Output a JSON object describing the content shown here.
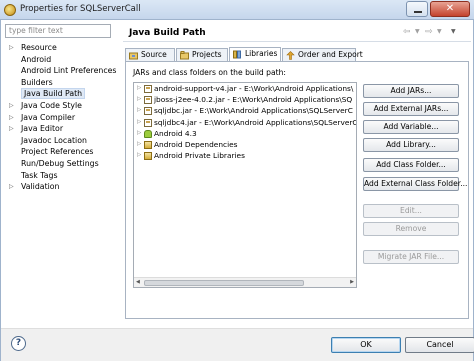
{
  "window": {
    "title": "Properties for SQLServerCall",
    "close_glyph": "✕"
  },
  "filter": {
    "placeholder": "type filter text"
  },
  "tree": [
    {
      "label": "Resource",
      "expandable": true
    },
    {
      "label": "Android",
      "expandable": false
    },
    {
      "label": "Android Lint Preferences",
      "expandable": false
    },
    {
      "label": "Builders",
      "expandable": false
    },
    {
      "label": "Java Build Path",
      "expandable": false,
      "selected": true
    },
    {
      "label": "Java Code Style",
      "expandable": true
    },
    {
      "label": "Java Compiler",
      "expandable": true
    },
    {
      "label": "Java Editor",
      "expandable": true
    },
    {
      "label": "Javadoc Location",
      "expandable": false
    },
    {
      "label": "Project References",
      "expandable": false
    },
    {
      "label": "Run/Debug Settings",
      "expandable": false
    },
    {
      "label": "Task Tags",
      "expandable": false
    },
    {
      "label": "Validation",
      "expandable": true
    }
  ],
  "page": {
    "title": "Java Build Path",
    "tabs": [
      {
        "label": "Source"
      },
      {
        "label": "Projects"
      },
      {
        "label": "Libraries"
      },
      {
        "label": "Order and Export"
      }
    ],
    "description": "JARs and class folders on the build path:"
  },
  "libraries": [
    {
      "label": "android-support-v4.jar - E:\\Work\\Android Applications\\",
      "icon": "jar-icon"
    },
    {
      "label": "jboss-j2ee-4.0.2.jar - E:\\Work\\Android Applications\\SQ",
      "icon": "jar-icon"
    },
    {
      "label": "sqljdbc.jar - E:\\Work\\Android Applications\\SQLServerC",
      "icon": "jar-icon"
    },
    {
      "label": "sqljdbc4.jar - E:\\Work\\Android Applications\\SQLServerC",
      "icon": "jar-icon"
    },
    {
      "label": "Android 4.3",
      "icon": "android-icon"
    },
    {
      "label": "Android Dependencies",
      "icon": "library-icon"
    },
    {
      "label": "Android Private Libraries",
      "icon": "library-icon"
    }
  ],
  "buttons": {
    "add_jars": "Add JARs...",
    "add_external_jars": "Add External JARs...",
    "add_variable": "Add Variable...",
    "add_library": "Add Library...",
    "add_class_folder": "Add Class Folder...",
    "add_external_class_folder": "Add External Class Folder...",
    "edit": "Edit...",
    "remove": "Remove",
    "migrate_jar": "Migrate JAR File..."
  },
  "footer": {
    "help": "?",
    "ok": "OK",
    "cancel": "Cancel"
  }
}
